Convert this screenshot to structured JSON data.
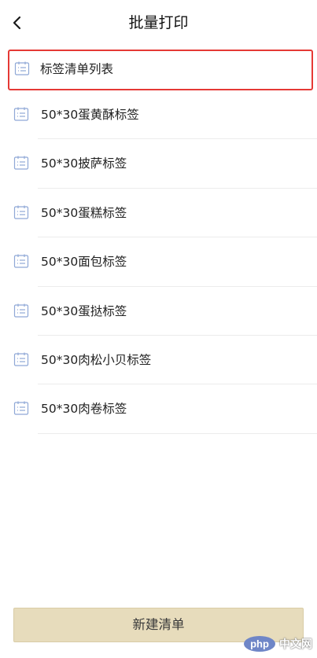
{
  "header": {
    "title": "批量打印",
    "back_icon": "chevron-left-icon"
  },
  "list": {
    "item_icon": "calendar-list-icon",
    "icon_color": "#8fa8d6",
    "items": [
      {
        "label": "标签清单列表",
        "selected": true
      },
      {
        "label": "50*30蛋黄酥标签"
      },
      {
        "label": "50*30披萨标签"
      },
      {
        "label": "50*30蛋糕标签"
      },
      {
        "label": "50*30面包标签"
      },
      {
        "label": "50*30蛋挞标签"
      },
      {
        "label": "50*30肉松小贝标签"
      },
      {
        "label": "50*30肉卷标签"
      }
    ]
  },
  "footer": {
    "new_button_label": "新建清单",
    "button_color": "#e7dcbc"
  },
  "watermark": {
    "logo_text": "php",
    "site_text": "中文网",
    "logo_color": "#6f86c7"
  },
  "colors": {
    "selected_border": "#e53935"
  }
}
